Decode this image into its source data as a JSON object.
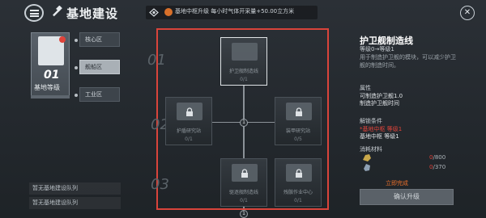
{
  "header": {
    "title": "基地建设",
    "notice": "基地中枢升级 每小时气体开采量+50.00立方米",
    "close_label": "✕"
  },
  "left": {
    "level_number": "01",
    "level_label": "基地等级",
    "zones": [
      "核心区",
      "舰船区",
      "工业区"
    ],
    "queues": [
      "暂无基地建设队列",
      "暂无基地建设队列"
    ]
  },
  "tree": {
    "row_labels": [
      "01",
      "02",
      "03"
    ],
    "nodes": [
      {
        "name": "护卫舰制造线",
        "count": "0/1"
      },
      {
        "name": "护盾研究站",
        "count": "0/1"
      },
      {
        "name": "装甲研究站",
        "count": "0/5"
      },
      {
        "name": "驱逐舰制造线",
        "count": "0/1"
      },
      {
        "name": "残骸作业中心",
        "count": "0/1"
      }
    ],
    "branch_badges": [
      "1",
      "1"
    ]
  },
  "detail": {
    "title": "护卫舰制造线",
    "level": "等级0→等级1",
    "desc_line1": "用于制造护卫舰的模块，可以减少护卫",
    "desc_line2": "舰的制造时间。",
    "attr_heading": "属性",
    "attrs": [
      "可制造护卫舰1.0",
      "制造护卫舰时间"
    ],
    "unlock_heading": "解锁条件",
    "unlock_conditions": [
      "*基地中枢 等级1",
      "基地中枢 等级1"
    ],
    "cost_heading": "消耗材料",
    "resources": [
      {
        "current": "0",
        "required": "/800"
      },
      {
        "current": "0",
        "required": "/370"
      }
    ],
    "complete_now": "立即完成",
    "upgrade_label": "确认升级"
  },
  "colors": {
    "accent_red": "#d9443b",
    "warning_orange": "#e86e2a"
  }
}
